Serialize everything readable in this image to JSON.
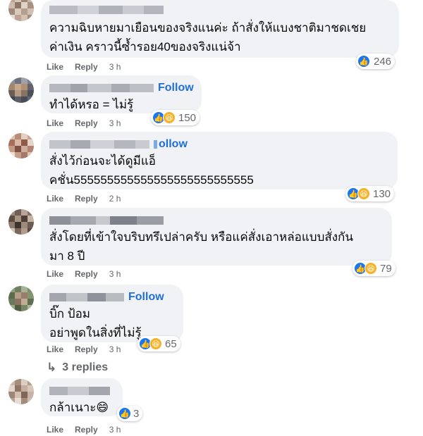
{
  "comments": [
    {
      "show_follow": false,
      "follow_label": "",
      "text": "ความฉิบหายมาเยือนของจริงแนค่ะ ถ้าสั่งให้แบงชาติมาชดเชย\nค่าเงิน คราวนี้ซ้ำรอย40ของจริงแน่จ้า",
      "like_label": "Like",
      "reply_label": "Reply",
      "time": "3 h",
      "reactions": [
        "like"
      ],
      "reaction_count": "246"
    },
    {
      "show_follow": true,
      "follow_label": "Follow",
      "text": "ทำได้หรอ = ไม่รู้",
      "like_label": "Like",
      "reply_label": "Reply",
      "time": "3 h",
      "reactions": [
        "like",
        "haha"
      ],
      "reaction_count": "150"
    },
    {
      "show_follow": true,
      "follow_label": "ollow",
      "text": "สั่งไว้ก่อนจะได้ดูมีแอ็\nคชั่น555555555555555555555555555",
      "like_label": "Like",
      "reply_label": "Reply",
      "time": "2 h",
      "reactions": [
        "like",
        "haha"
      ],
      "reaction_count": "130"
    },
    {
      "show_follow": false,
      "follow_label": "",
      "text": "สั่งโดยที่เข้าใจบริบทรึเปล่าครับ หรือแค่สั่งเอาหล่อแบบสั่งกัน\nมา 8 ปี",
      "like_label": "Like",
      "reply_label": "Reply",
      "time": "3 h",
      "reactions": [
        "like",
        "haha"
      ],
      "reaction_count": "79"
    },
    {
      "show_follow": true,
      "follow_label": "Follow",
      "text": "บิ๊ก ป้อม\nอย่าพูดในสิ่งที่ไม่รู้",
      "like_label": "Like",
      "reply_label": "Reply",
      "time": "3 h",
      "reactions": [
        "like",
        "haha"
      ],
      "reaction_count": "65"
    },
    {
      "show_follow": false,
      "follow_label": "",
      "text": "กล้าเนาะ😄",
      "like_label": "Like",
      "reply_label": "Reply",
      "time": "3 h",
      "reactions": [
        "like"
      ],
      "reaction_count": "3"
    }
  ],
  "replies_link": "3 replies",
  "colors": {
    "bubble_bg": "#f0f2f5",
    "follow_blue": "#216fdb",
    "meta_gray": "#65676b",
    "like_blue": "#1877f2",
    "haha_yellow": "#f7b125"
  }
}
